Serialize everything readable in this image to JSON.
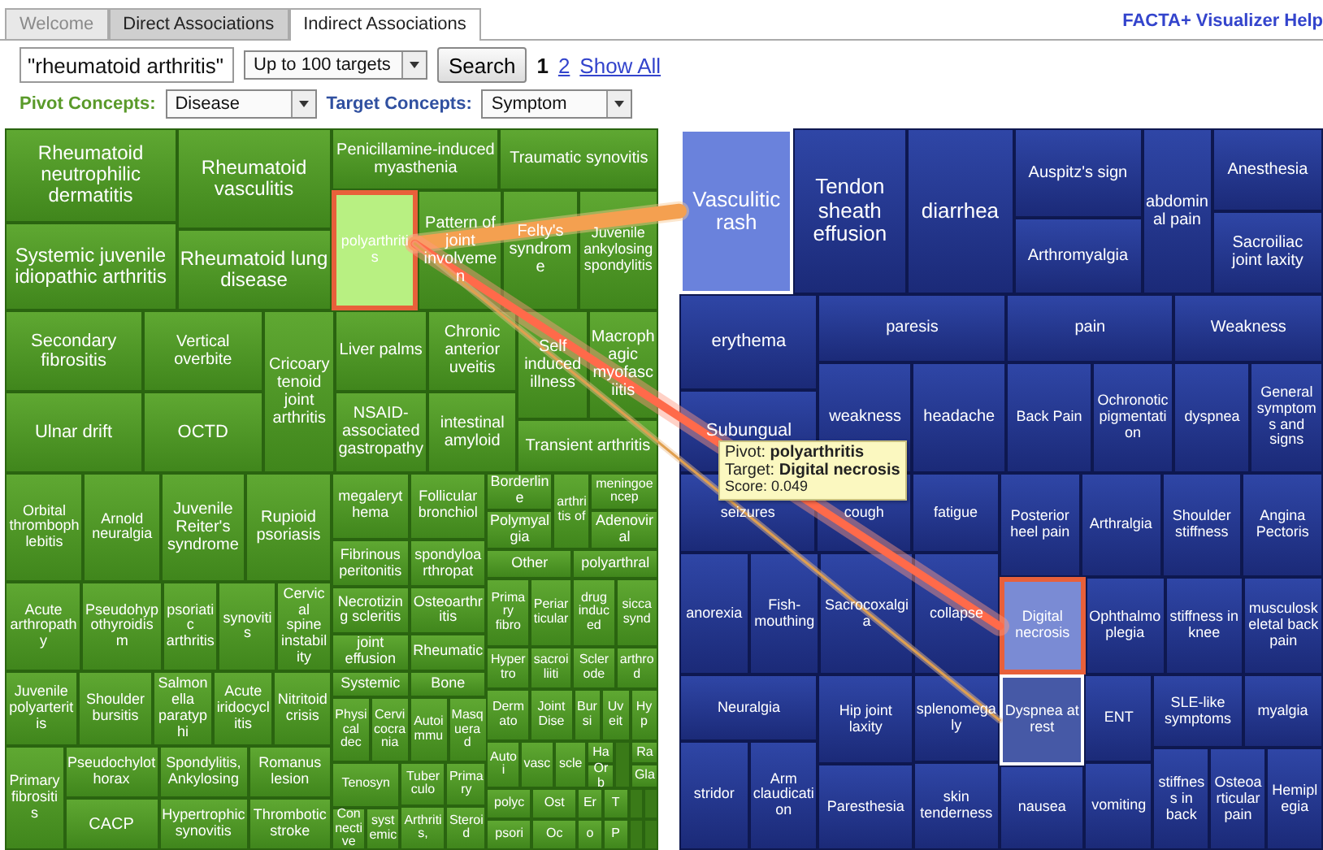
{
  "tabs": [
    {
      "label": "Welcome",
      "selected": false,
      "disabled": true
    },
    {
      "label": "Direct Associations",
      "selected": false,
      "disabled": false
    },
    {
      "label": "Indirect Associations",
      "selected": true,
      "disabled": false
    }
  ],
  "help_link": "FACTA+ Visualizer Help",
  "search": {
    "query": "\"rheumatoid arthritis\"",
    "limit": "Up to 100 targets",
    "button": "Search",
    "pages": [
      {
        "label": "1",
        "selected": true
      },
      {
        "label": "2",
        "selected": false
      }
    ],
    "show_all": "Show All"
  },
  "filters": [
    {
      "label": "Pivot Concepts:",
      "value": "Disease",
      "color": "#5a9a2a"
    },
    {
      "label": "Target Concepts:",
      "value": "Symptom",
      "color": "#3050a0"
    }
  ],
  "pivot_map": {
    "tiles": [
      {
        "label": "Rheumatoid neutrophilic dermatitis",
        "selected": false
      },
      {
        "label": "Systemic juvenile idiopathic arthritis",
        "selected": false
      },
      {
        "label": "Rheumatoid vasculitis",
        "selected": false
      },
      {
        "label": "Rheumatoid lung disease",
        "selected": false
      },
      {
        "label": "Penicillamine-induced myasthenia",
        "selected": false
      },
      {
        "label": "Traumatic synovitis",
        "selected": false
      },
      {
        "label": "polyarthritis",
        "selected": true
      },
      {
        "label": "Pattern of joint involvemen",
        "selected": false
      },
      {
        "label": "Felty's syndrome",
        "selected": false
      },
      {
        "label": "Juvenile ankylosing spondylitis",
        "selected": false
      },
      {
        "label": "Secondary fibrositis",
        "selected": false
      },
      {
        "label": "Ulnar drift",
        "selected": false
      },
      {
        "label": "Vertical overbite",
        "selected": false
      },
      {
        "label": "OCTD",
        "selected": false
      },
      {
        "label": "Cricoarytenoid joint arthritis",
        "selected": false
      },
      {
        "label": "Liver palms",
        "selected": false
      },
      {
        "label": "NSAID-associated gastropathy",
        "selected": false
      },
      {
        "label": "Chronic anterior uveitis",
        "selected": false
      },
      {
        "label": "intestinal amyloid",
        "selected": false
      },
      {
        "label": "Self induced illness",
        "selected": false
      },
      {
        "label": "Macrophagic myofasciitis",
        "selected": false
      },
      {
        "label": "Transient arthritis",
        "selected": false
      },
      {
        "label": "Orbital thrombophlebitis",
        "selected": false
      },
      {
        "label": "Arnold neuralgia",
        "selected": false
      },
      {
        "label": "Juvenile Reiter's syndrome",
        "selected": false
      },
      {
        "label": "Rupioid psoriasis",
        "selected": false
      },
      {
        "label": "Acute arthropathy",
        "selected": false
      },
      {
        "label": "Pseudohypothyroidism",
        "selected": false
      },
      {
        "label": "psoriatic arthritis",
        "selected": false
      },
      {
        "label": "synovitis",
        "selected": false
      },
      {
        "label": "Cervical spine instability",
        "selected": false
      },
      {
        "label": "Juvenile polyarteritis",
        "selected": false
      },
      {
        "label": "Shoulder bursitis",
        "selected": false
      },
      {
        "label": "Salmonella paratyphi",
        "selected": false
      },
      {
        "label": "Acute iridocyclitis",
        "selected": false
      },
      {
        "label": "Nitritoid crisis",
        "selected": false
      },
      {
        "label": "Primary fibrositis",
        "selected": false
      },
      {
        "label": "Pseudochylothorax",
        "selected": false
      },
      {
        "label": "CACP",
        "selected": false
      },
      {
        "label": "Spondylitis, Ankylosing",
        "selected": false
      },
      {
        "label": "Hypertrophic synovitis",
        "selected": false
      },
      {
        "label": "Romanus lesion",
        "selected": false
      },
      {
        "label": "Thrombotic stroke",
        "selected": false
      },
      {
        "label": "megalerythema",
        "selected": false
      },
      {
        "label": "Follicular bronchiol",
        "selected": false
      },
      {
        "label": "Fibrinous peritonitis",
        "selected": false
      },
      {
        "label": "spondyloarthropat",
        "selected": false
      },
      {
        "label": "Necrotizing scleritis",
        "selected": false
      },
      {
        "label": "Osteoarthritis",
        "selected": false
      },
      {
        "label": "joint effusion",
        "selected": false
      },
      {
        "label": "Rheumatic",
        "selected": false
      },
      {
        "label": "Systemic",
        "selected": false
      },
      {
        "label": "Bone",
        "selected": false
      },
      {
        "label": "Physical dec",
        "selected": false
      },
      {
        "label": "Cervicocrania",
        "selected": false
      },
      {
        "label": "Autoimmu",
        "selected": false
      },
      {
        "label": "Masquerad",
        "selected": false
      },
      {
        "label": "Tenosyn",
        "selected": false
      },
      {
        "label": "Connective",
        "selected": false
      },
      {
        "label": "systemic",
        "selected": false
      },
      {
        "label": "Tuberculo",
        "selected": false
      },
      {
        "label": "Arthritis,",
        "selected": false
      },
      {
        "label": "Primary",
        "selected": false
      },
      {
        "label": "Steroid",
        "selected": false
      },
      {
        "label": "Borderline",
        "selected": false
      },
      {
        "label": "Polymyalgia",
        "selected": false
      },
      {
        "label": "arthritis of",
        "selected": false
      },
      {
        "label": "meningoencep",
        "selected": false
      },
      {
        "label": "Adenoviral",
        "selected": false
      },
      {
        "label": "Other",
        "selected": false
      },
      {
        "label": "polyarthral",
        "selected": false
      },
      {
        "label": "Primary fibro",
        "selected": false
      },
      {
        "label": "Periarticular",
        "selected": false
      },
      {
        "label": "drug induced",
        "selected": false
      },
      {
        "label": "sicca synd",
        "selected": false
      },
      {
        "label": "Hypertro",
        "selected": false
      },
      {
        "label": "sacroiliiti",
        "selected": false
      },
      {
        "label": "Sclerode",
        "selected": false
      },
      {
        "label": "arthrod",
        "selected": false
      },
      {
        "label": "Dermato",
        "selected": false
      },
      {
        "label": "Joint Dise",
        "selected": false
      },
      {
        "label": "Bursi",
        "selected": false
      },
      {
        "label": "Uveit",
        "selected": false
      },
      {
        "label": "Hyp",
        "selected": false
      },
      {
        "label": "Autoi",
        "selected": false
      },
      {
        "label": "vasc",
        "selected": false
      },
      {
        "label": "scle",
        "selected": false
      },
      {
        "label": "Ha",
        "selected": false
      },
      {
        "label": "Orb",
        "selected": false
      },
      {
        "label": "Ra",
        "selected": false
      },
      {
        "label": "Gla",
        "selected": false
      },
      {
        "label": "polyc",
        "selected": false
      },
      {
        "label": "Ost",
        "selected": false
      },
      {
        "label": "Er",
        "selected": false
      },
      {
        "label": "T",
        "selected": false
      },
      {
        "label": "psori",
        "selected": false
      },
      {
        "label": "Oc",
        "selected": false
      },
      {
        "label": "o",
        "selected": false
      },
      {
        "label": "P",
        "selected": false
      }
    ]
  },
  "target_map": {
    "tiles": [
      {
        "label": "Vasculitic rash",
        "selected": false,
        "linked": true,
        "strong": true
      },
      {
        "label": "Tendon sheath effusion",
        "selected": false
      },
      {
        "label": "diarrhea",
        "selected": false
      },
      {
        "label": "Auspitz's sign",
        "selected": false
      },
      {
        "label": "Arthromyalgia",
        "selected": false
      },
      {
        "label": "abdominal pain",
        "selected": false
      },
      {
        "label": "Anesthesia",
        "selected": false
      },
      {
        "label": "Sacroiliac joint laxity",
        "selected": false
      },
      {
        "label": "erythema",
        "selected": false
      },
      {
        "label": "Subungual",
        "selected": false
      },
      {
        "label": "paresis",
        "selected": false
      },
      {
        "label": "weakness",
        "selected": false
      },
      {
        "label": "headache",
        "selected": false
      },
      {
        "label": "pain",
        "selected": false
      },
      {
        "label": "Weakness",
        "selected": false
      },
      {
        "label": "Back Pain",
        "selected": false
      },
      {
        "label": "Ochronotic pigmentation",
        "selected": false
      },
      {
        "label": "dyspnea",
        "selected": false
      },
      {
        "label": "General symptoms and signs",
        "selected": false
      },
      {
        "label": "seizures",
        "selected": false
      },
      {
        "label": "cough",
        "selected": false
      },
      {
        "label": "fatigue",
        "selected": false
      },
      {
        "label": "anorexia",
        "selected": false
      },
      {
        "label": "Fish-mouthing",
        "selected": false
      },
      {
        "label": "Sacrocoxalgia",
        "selected": false
      },
      {
        "label": "collapse",
        "selected": false
      },
      {
        "label": "Neuralgia",
        "selected": false
      },
      {
        "label": "stridor",
        "selected": false
      },
      {
        "label": "Arm claudication",
        "selected": false
      },
      {
        "label": "Hip joint laxity",
        "selected": false
      },
      {
        "label": "Paresthesia",
        "selected": false
      },
      {
        "label": "splenomegaly",
        "selected": false
      },
      {
        "label": "skin tenderness",
        "selected": false
      },
      {
        "label": "Posterior heel pain",
        "selected": false
      },
      {
        "label": "Arthralgia",
        "selected": false
      },
      {
        "label": "Shoulder stiffness",
        "selected": false
      },
      {
        "label": "Angina Pectoris",
        "selected": false
      },
      {
        "label": "Digital necrosis",
        "selected": true
      },
      {
        "label": "Ophthalmoplegia",
        "selected": false
      },
      {
        "label": "stiffness in knee",
        "selected": false
      },
      {
        "label": "musculoskeletal back pain",
        "selected": false
      },
      {
        "label": "Dyspnea at rest",
        "selected": false,
        "linked": true,
        "strong": false
      },
      {
        "label": "nausea",
        "selected": false
      },
      {
        "label": "ENT",
        "selected": false
      },
      {
        "label": "vomiting",
        "selected": false
      },
      {
        "label": "SLE-like symptoms",
        "selected": false
      },
      {
        "label": "myalgia",
        "selected": false
      },
      {
        "label": "stiffness in back",
        "selected": false
      },
      {
        "label": "Osteoarticular pain",
        "selected": false
      },
      {
        "label": "Hemiplegia",
        "selected": false
      }
    ]
  },
  "tooltip": {
    "lines": [
      "Pivot: **polyarthritis**",
      "Target: **Digital necrosis**",
      "Score: 0.049"
    ]
  }
}
